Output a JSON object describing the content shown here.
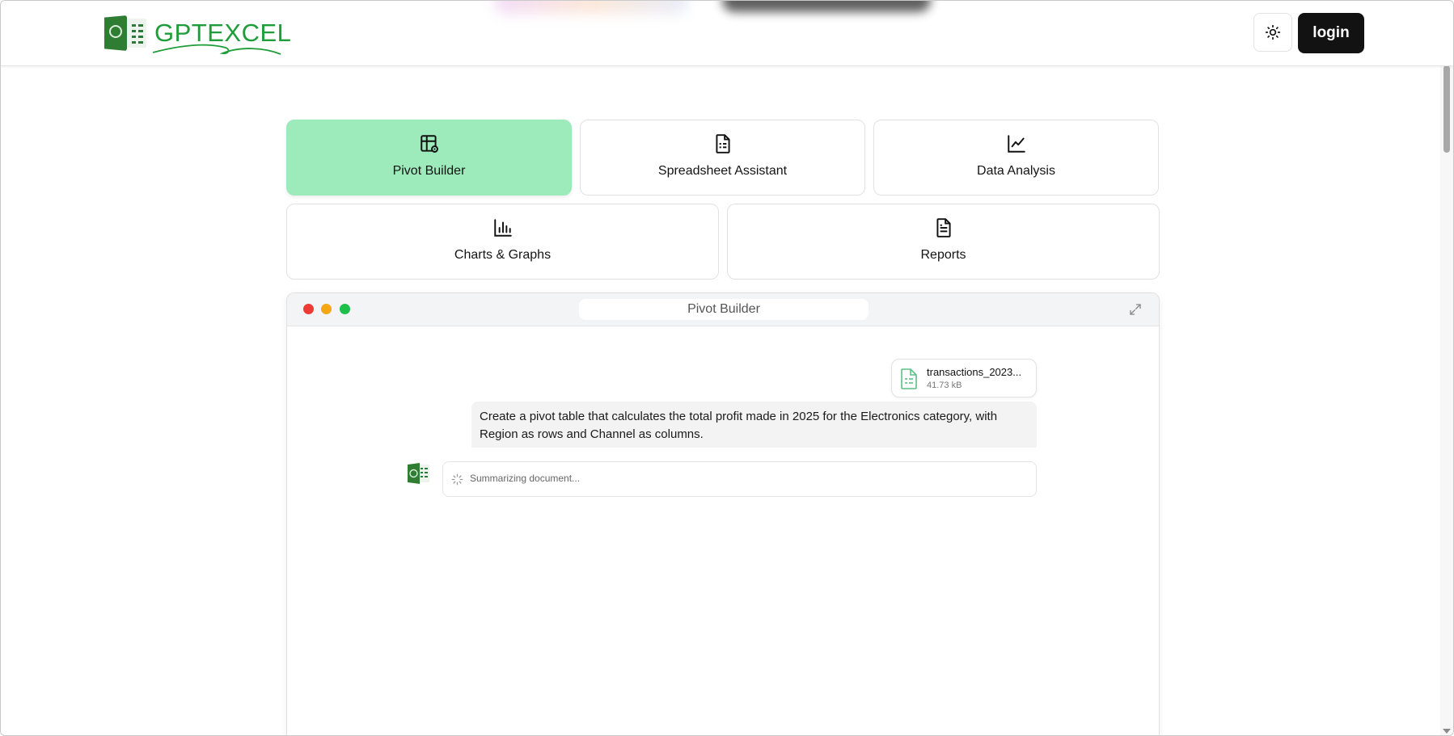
{
  "header": {
    "logo_text": "GPTEXCEL",
    "login_label": "login",
    "theme_icon": "sun-icon"
  },
  "tabs": [
    {
      "label": "Pivot Builder",
      "icon": "pivot-table-icon",
      "active": true
    },
    {
      "label": "Spreadsheet Assistant",
      "icon": "sheet-file-icon",
      "active": false
    },
    {
      "label": "Data Analysis",
      "icon": "line-chart-icon",
      "active": false
    },
    {
      "label": "Charts & Graphs",
      "icon": "bar-chart-icon",
      "active": false
    },
    {
      "label": "Reports",
      "icon": "document-icon",
      "active": false
    }
  ],
  "window": {
    "title": "Pivot Builder",
    "traffic_colors": [
      "#ef3b36",
      "#f3a712",
      "#1ec04a"
    ],
    "expand_icon": "expand-icon"
  },
  "chat": {
    "file": {
      "name": "transactions_2023...",
      "size": "41.73 kB",
      "icon": "spreadsheet-file-icon"
    },
    "user_message": "Create a pivot table that calculates the total profit made in 2025 for the Electronics category, with Region as rows and Channel as columns.",
    "bot_status": "Summarizing document..."
  },
  "colors": {
    "accent_green": "#1f9d3a",
    "active_tab": "#9deabb",
    "login_bg": "#121212"
  }
}
